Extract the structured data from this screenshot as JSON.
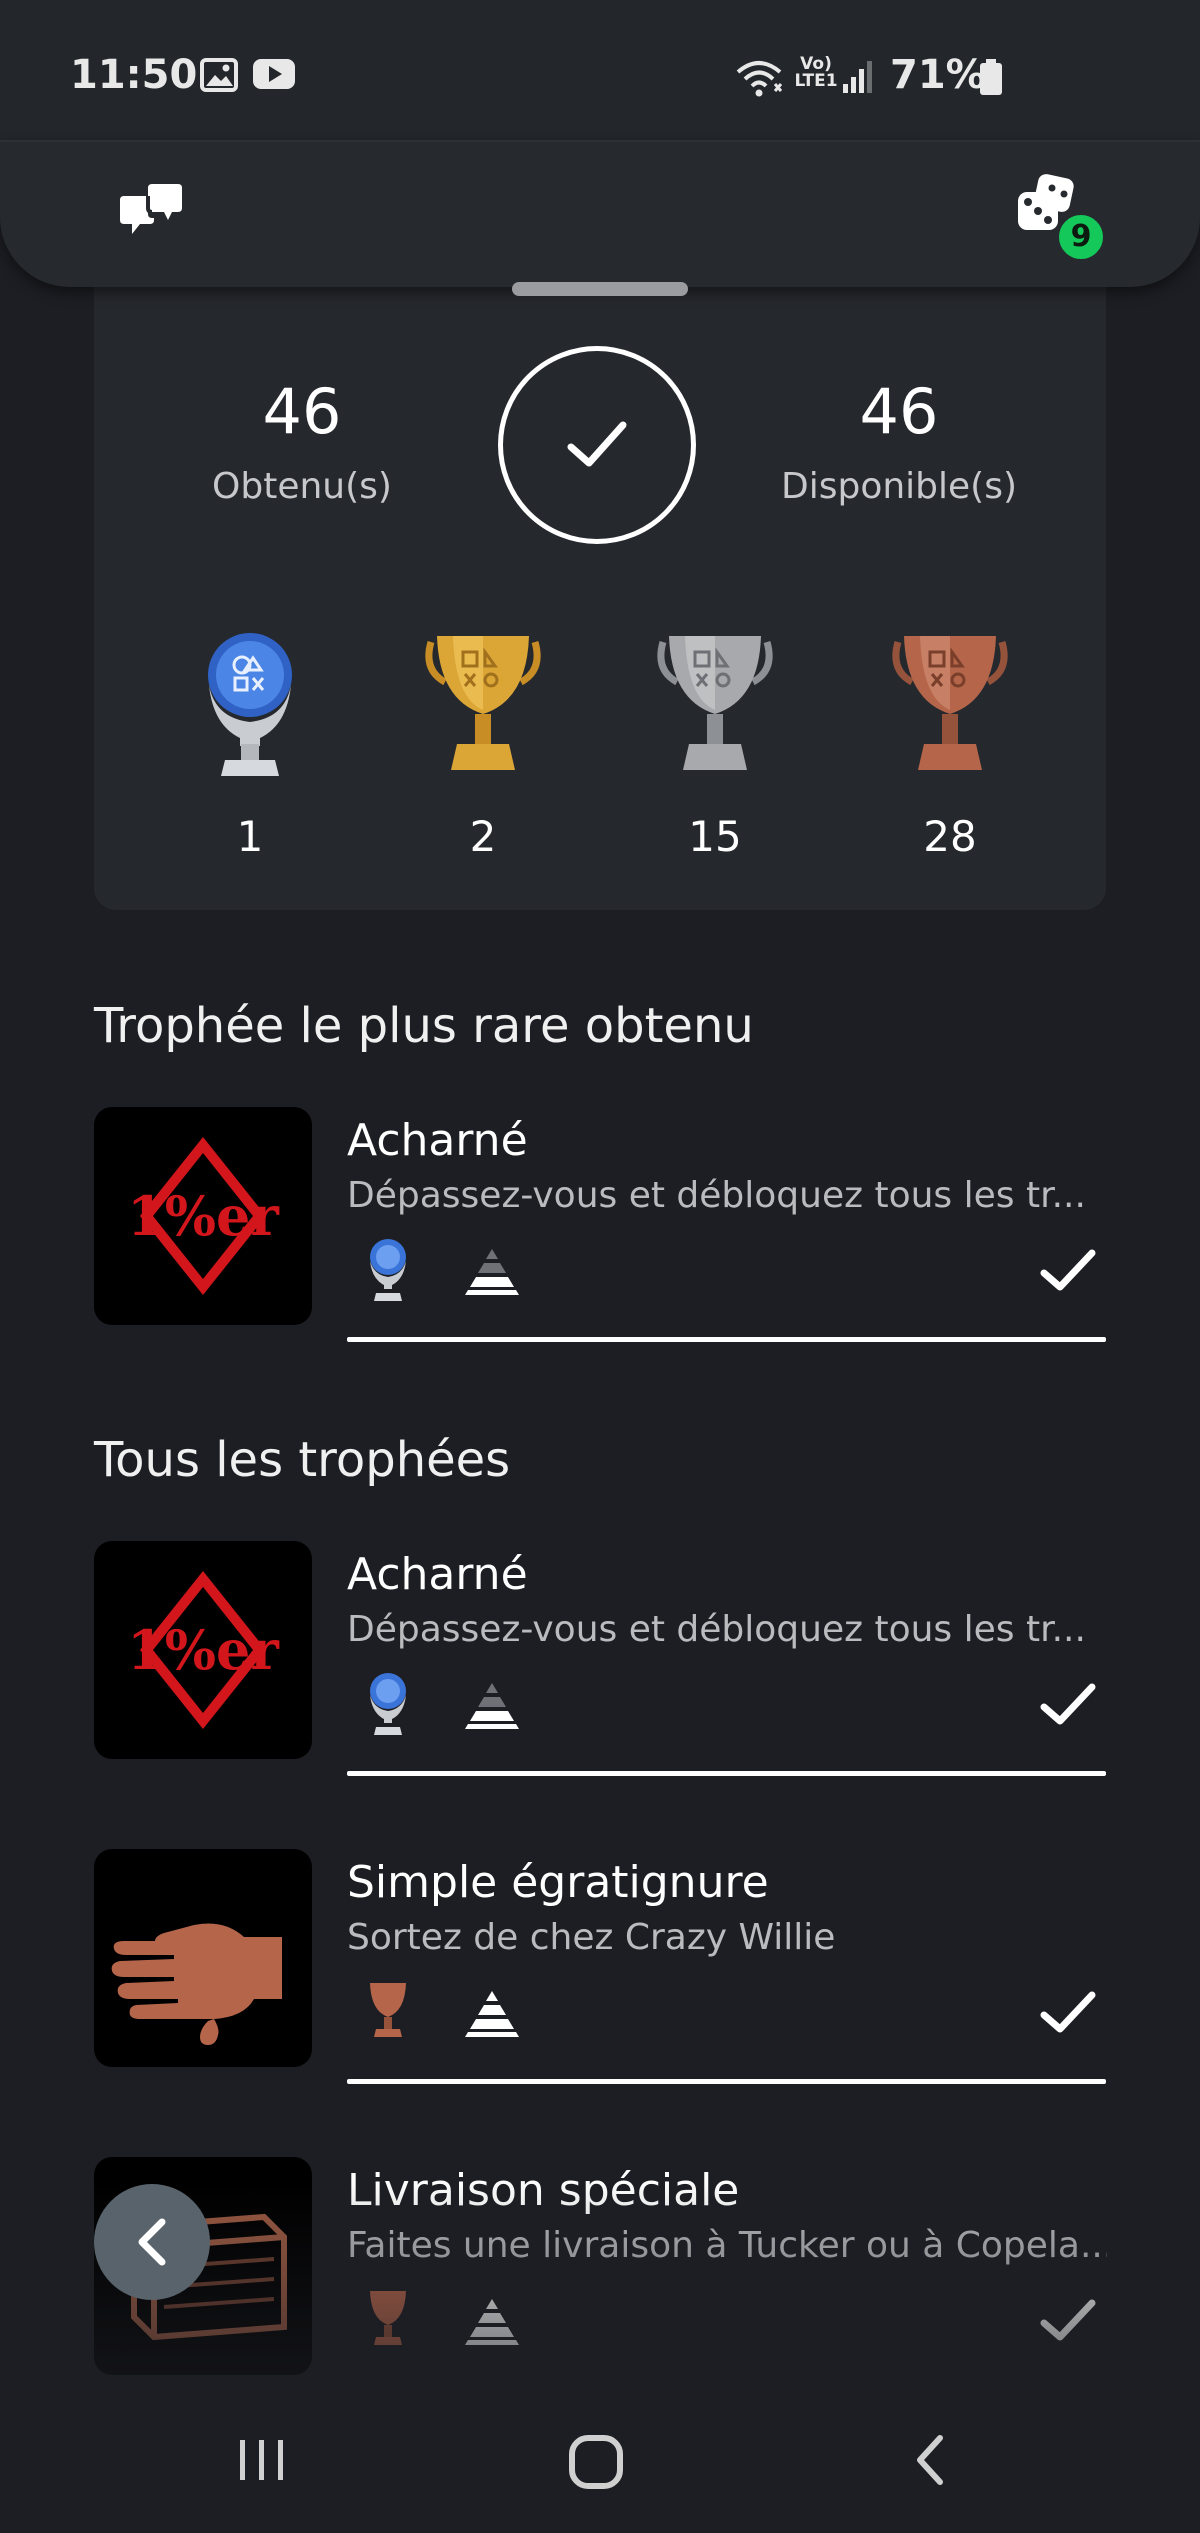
{
  "status_bar": {
    "time": "11:50",
    "network_label": "Vo) LTE1",
    "battery": "71%"
  },
  "top_bar": {
    "notification_count": "9"
  },
  "summary": {
    "earned_count": "46",
    "earned_label": "Obtenu(s)",
    "available_count": "46",
    "available_label": "Disponible(s)",
    "trophy_counts": {
      "platinum": "1",
      "gold": "2",
      "silver": "15",
      "bronze": "28"
    }
  },
  "rarest_section": {
    "title": "Trophée le plus rare obtenu",
    "item": {
      "name": "Acharné",
      "description": "Dépassez-vous et débloquez tous les tr...",
      "trophy_type": "platinum",
      "thumb_text": "1%er"
    }
  },
  "all_section": {
    "title": "Tous les trophées",
    "items": [
      {
        "name": "Acharné",
        "description": "Dépassez-vous et débloquez tous les tr...",
        "trophy_type": "platinum",
        "thumb_text": "1%er"
      },
      {
        "name": "Simple égratignure",
        "description": "Sortez de chez Crazy Willie",
        "trophy_type": "bronze"
      },
      {
        "name": "Livraison spéciale",
        "description": "Faites une livraison à Tucker ou à Copela...",
        "trophy_type": "bronze"
      }
    ]
  },
  "colors": {
    "background": "#1d1e24",
    "card": "#25282d",
    "badge_green": "#14c95a",
    "platinum_blue": "#3b74d9",
    "gold": "#d9a130",
    "silver": "#a7a9ac",
    "bronze": "#b5654a",
    "emblem_red": "#d2161b"
  }
}
